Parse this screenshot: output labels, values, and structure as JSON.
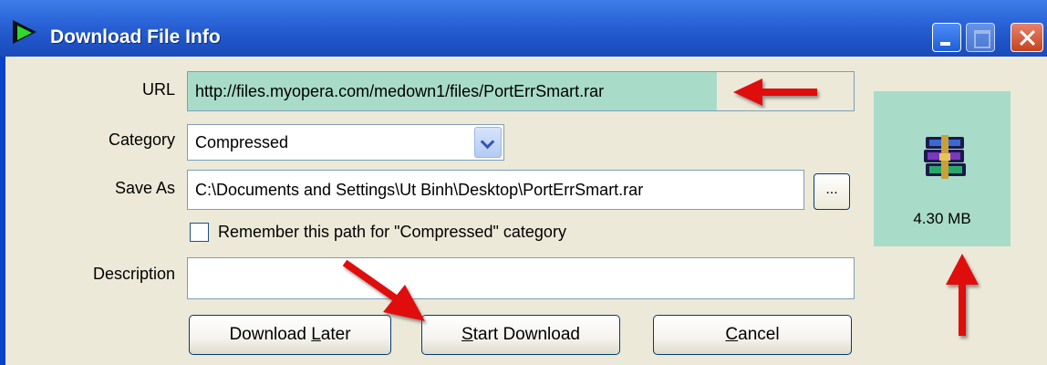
{
  "window": {
    "title": "Download File Info"
  },
  "form": {
    "url_label": "URL",
    "url_value": "http://files.myopera.com/medown1/files/PortErrSmart.rar",
    "category_label": "Category",
    "category_value": "Compressed",
    "saveas_label": "Save As",
    "saveas_value": "C:\\Documents and Settings\\Ut Binh\\Desktop\\PortErrSmart.rar",
    "browse_label": "...",
    "remember_label": "Remember this path for \"Compressed\" category",
    "description_label": "Description",
    "description_value": ""
  },
  "buttons": {
    "download_later_prefix": "Download ",
    "download_later_mnemonic": "L",
    "download_later_suffix": "ater",
    "start_mnemonic": "S",
    "start_suffix": "tart Download",
    "cancel_mnemonic": "C",
    "cancel_suffix": "ancel"
  },
  "file": {
    "size": "4.30  MB",
    "icon": "winrar-archive-icon"
  },
  "colors": {
    "highlight": "#a8dcc8",
    "arrow": "#e01010",
    "titlebar": "#2a64d8"
  }
}
